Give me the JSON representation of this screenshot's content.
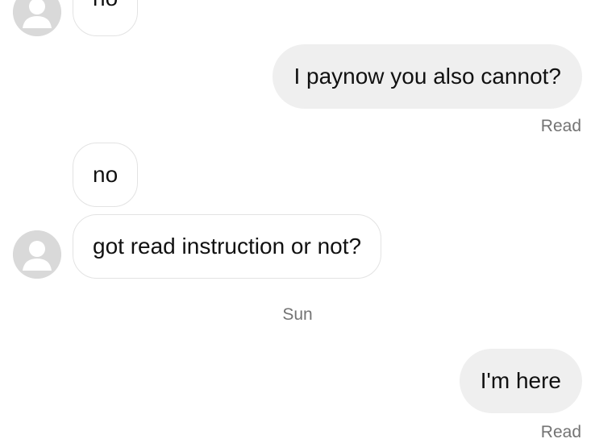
{
  "conversation": {
    "messages": [
      {
        "direction": "incoming",
        "text": "no"
      },
      {
        "direction": "outgoing",
        "text": "I paynow you also cannot?"
      },
      {
        "direction": "incoming",
        "text": "no"
      },
      {
        "direction": "incoming",
        "text": "got read instruction or not?"
      },
      {
        "direction": "outgoing",
        "text": "I'm here"
      }
    ],
    "read_receipt_1": "Read",
    "day_separator": "Sun",
    "read_receipt_2": "Read"
  },
  "avatar_icon": "user-silhouette-icon",
  "colors": {
    "background": "#ffffff",
    "outgoing_bubble": "#efefef",
    "incoming_border": "#e3e3e3",
    "meta_text": "#737373",
    "avatar": "#d9d9d9"
  }
}
